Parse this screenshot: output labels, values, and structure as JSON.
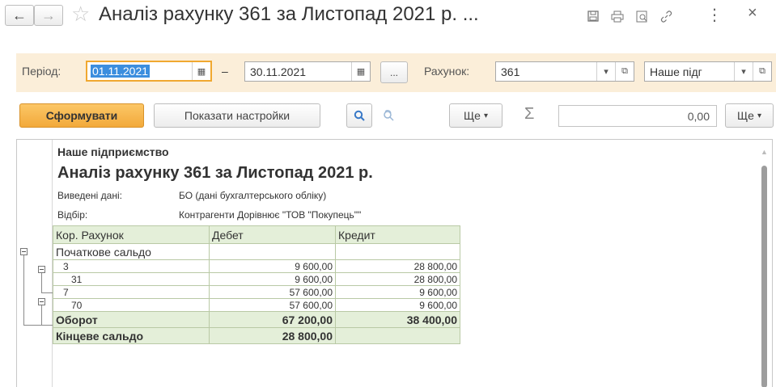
{
  "window": {
    "title": "Аналіз рахунку 361 за Листопад 2021 р. ...",
    "back_icon": "arrow-left-icon",
    "forward_icon": "arrow-right-icon",
    "star_icon": "star-icon",
    "more_label": "⋮",
    "close_label": "×"
  },
  "filters": {
    "period_label": "Період:",
    "date_from": "01.11.2021",
    "dash": "–",
    "date_to": "30.11.2021",
    "ellipsis_label": "...",
    "account_label": "Рахунок:",
    "account_value": "361",
    "org_value": "Наше підг"
  },
  "toolbar": {
    "generate_label": "Сформувати",
    "settings_label": "Показати настройки",
    "more1_label": "Ще",
    "sigma_label": "Σ",
    "sum_value": "0,00",
    "more2_label": "Ще"
  },
  "report": {
    "company": "Наше підприємство",
    "title": "Аналіз рахунку 361 за Листопад 2021 р.",
    "shown_data_label": "Виведені дані:",
    "shown_data_value": "БО (дані бухгалтерського обліку)",
    "filter_label": "Відбір:",
    "filter_value": "Контрагенти Дорівнює \"ТОВ \"Покупець\"\"",
    "columns": [
      "Кор. Рахунок",
      "Дебет",
      "Кредит"
    ],
    "opening_balance": "Початкове сальдо",
    "rows": [
      {
        "account": "3",
        "debit": "9 600,00",
        "credit": "28 800,00"
      },
      {
        "account": "31",
        "debit": "9 600,00",
        "credit": "28 800,00"
      },
      {
        "account": "7",
        "debit": "57 600,00",
        "credit": "9 600,00"
      },
      {
        "account": "70",
        "debit": "57 600,00",
        "credit": "9 600,00"
      }
    ],
    "turnover": {
      "label": "Оборот",
      "debit": "67 200,00",
      "credit": "38 400,00"
    },
    "closing": {
      "label": "Кінцеве сальдо",
      "debit": "28 800,00",
      "credit": ""
    }
  }
}
